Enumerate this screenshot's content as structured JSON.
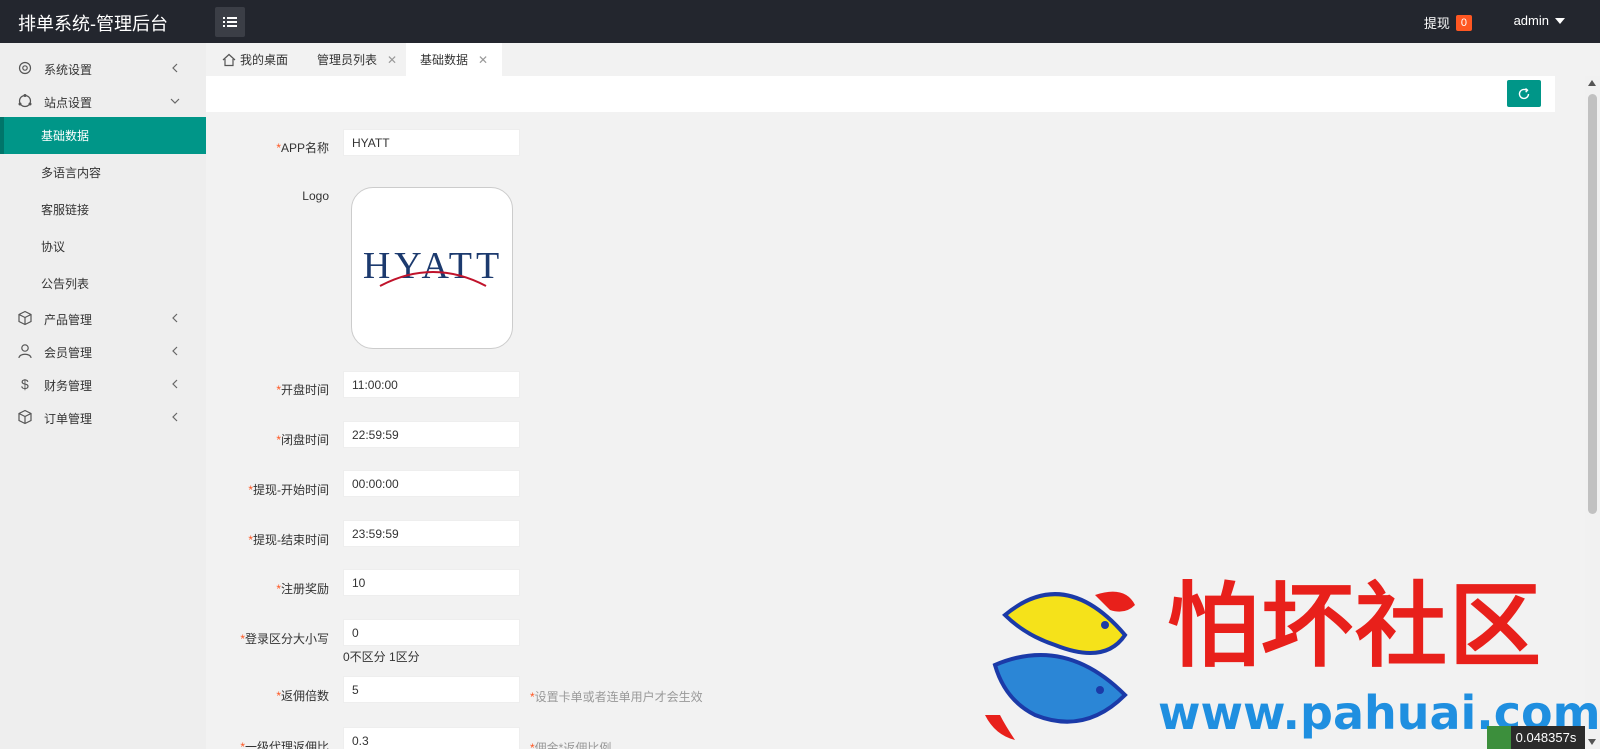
{
  "header": {
    "brand": "排单系统-管理后台",
    "withdraw_label": "提现",
    "withdraw_count": "0",
    "user": "admin"
  },
  "sidebar": {
    "groups": [
      {
        "label": "系统设置",
        "icon": "gear-icon"
      },
      {
        "label": "站点设置",
        "icon": "site-icon"
      },
      {
        "label": "产品管理",
        "icon": "box-icon"
      },
      {
        "label": "会员管理",
        "icon": "user-icon"
      },
      {
        "label": "财务管理",
        "icon": "dollar-icon"
      },
      {
        "label": "订单管理",
        "icon": "box-icon"
      }
    ],
    "sub_items": [
      {
        "label": "基础数据",
        "active": true
      },
      {
        "label": "多语言内容",
        "active": false
      },
      {
        "label": "客服链接",
        "active": false
      },
      {
        "label": "协议",
        "active": false
      },
      {
        "label": "公告列表",
        "active": false
      }
    ]
  },
  "tabs": [
    {
      "label": "我的桌面",
      "icon": "home-icon"
    },
    {
      "label": "管理员列表",
      "closable": true
    },
    {
      "label": "基础数据",
      "closable": true,
      "active": true
    }
  ],
  "form": {
    "fields": [
      {
        "label": "APP名称",
        "required": true,
        "value": "HYATT"
      },
      {
        "label": "Logo",
        "required": false,
        "logo_text": "HYATT"
      },
      {
        "label": "开盘时间",
        "required": true,
        "value": "11:00:00"
      },
      {
        "label": "闭盘时间",
        "required": true,
        "value": "22:59:59"
      },
      {
        "label": "提现-开始时间",
        "required": true,
        "value": "00:00:00"
      },
      {
        "label": "提现-结束时间",
        "required": true,
        "value": "23:59:59"
      },
      {
        "label": "注册奖励",
        "required": true,
        "value": "10"
      },
      {
        "label": "登录区分大小写",
        "required": true,
        "value": "0",
        "sub_hint": "0不区分 1区分"
      },
      {
        "label": "返佣倍数",
        "required": true,
        "value": "5",
        "hint": "设置卡单或者连单用户才会生效"
      },
      {
        "label": "一级代理返佣比",
        "required": true,
        "value": "0.3",
        "hint": "佣金*返佣比例"
      }
    ]
  },
  "watermark": {
    "text": "怕坏社区",
    "url": "www.pahuai.com"
  },
  "timer": "0.048357s",
  "colors": {
    "header_bg": "#23262e",
    "accent": "#009688",
    "badge": "#ff5722",
    "required": "#ff5722"
  }
}
